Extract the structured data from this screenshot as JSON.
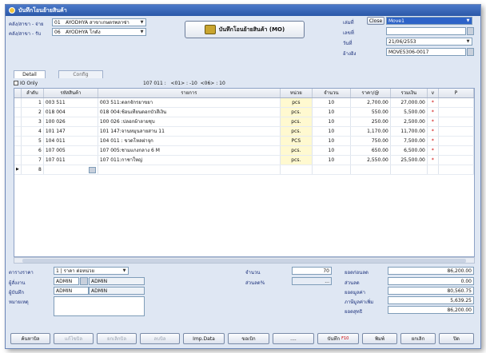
{
  "window": {
    "title": "บันทึกโอนย้ายสินค้า"
  },
  "header": {
    "from_label": "คลัง/สาขา - จ่าย",
    "from_code": "01",
    "from_name": "AYODHYA สาขาเกษตรพลาซ่า",
    "to_label": "คลัง/สาขา - รับ",
    "to_code": "06",
    "to_name": "AYODHYA โกดัง",
    "save_big_label": "บันทึกโอนย้ายสินค้า (MO)"
  },
  "doc": {
    "type_label": "เล่มที่",
    "close_label": "Close",
    "type_value": "Move1",
    "number_label": "เลขที่",
    "number_value": "",
    "date_label": "วันที่",
    "date_value": "21/06/2553",
    "ref_label": "อ้างอิง",
    "ref_value": "MOVE5306-0017"
  },
  "tabs": [
    {
      "label": "Detail"
    },
    {
      "label": "Config"
    }
  ],
  "io_only_label": "IO Only",
  "summary_line": "107 011 :   <01> : -10  <06> : 10",
  "columns": [
    "ลำดับ",
    "รหัสสินค้า",
    "รายการ",
    "หน่วย",
    "จำนวน",
    "ราคา/@",
    "รวมเงิน",
    "v",
    "P"
  ],
  "rows": [
    {
      "no": "1",
      "code": "003 511",
      "name": "003 511:ตลกจักรยาขยา",
      "unit": "pcs",
      "qty": "10",
      "price": "2,700.00",
      "total": "27,000.00",
      "v": "*"
    },
    {
      "no": "2",
      "code": "018 004",
      "name": "018 004:ช้อนเทียนดอกบัวสีเงิน",
      "unit": "pcs.",
      "qty": "10",
      "price": "550.00",
      "total": "5,500.00",
      "v": "*"
    },
    {
      "no": "3",
      "code": "100 026",
      "name": "100 026 :ปลอกผ้าลายชุบ",
      "unit": "pcs.",
      "qty": "10",
      "price": "250.00",
      "total": "2,500.00",
      "v": "*"
    },
    {
      "no": "4",
      "code": "101 147",
      "name": "101 147:จานหมุนลายสาน  11",
      "unit": "pcs.",
      "qty": "10",
      "price": "1,170.00",
      "total": "11,700.00",
      "v": "*"
    },
    {
      "no": "5",
      "code": "104 011",
      "name": "104 011 : ขวดโหลฝาจุก",
      "unit": "PCS",
      "qty": "10",
      "price": "750.00",
      "total": "7,500.00",
      "v": "*"
    },
    {
      "no": "6",
      "code": "107 005",
      "name": "107 005:ชามแกงกลาง  6    M",
      "unit": "pcs.",
      "qty": "10",
      "price": "650.00",
      "total": "6,500.00",
      "v": "*"
    },
    {
      "no": "7",
      "code": "107 011",
      "name": "107 011:กาชาใหญ่",
      "unit": "pcs.",
      "qty": "10",
      "price": "2,550.00",
      "total": "25,500.00",
      "v": "*"
    },
    {
      "no": "8",
      "code": "",
      "name": "",
      "unit": "",
      "qty": "",
      "price": "",
      "total": "",
      "v": ""
    }
  ],
  "bottom": {
    "price_level_label": "ตารางราคา",
    "price_level_value": "1 | ราคา ต่อหน่วย",
    "orderer_label": "ผู้สั่งงาน",
    "orderer_code": "ADMIN",
    "orderer_name": "ADMIN",
    "recorder_label": "ผู้บันทึก",
    "recorder_code": "ADMIN",
    "recorder_name": "ADMIN",
    "note_label": "หมายเหตุ",
    "qty_label": "จำนวน",
    "qty_value": "70",
    "discount_pct_label": "ส่วนลด%",
    "discount_pct_value": "...",
    "subtotal_label": "ยอดก่อนลด",
    "subtotal_value": "86,200.00",
    "discount_label": "ส่วนลด",
    "discount_value": "0.00",
    "net_value_label": "ยอดมูลค่า",
    "net_value_value": "80,560.75",
    "vat_label": "ภาษีมูลค่าเพิ่ม",
    "vat_value": "5,639.25",
    "grand_label": "ยอดสุทธิ",
    "grand_value": "86,200.00"
  },
  "buttons": {
    "search": "ค้นหาบิล",
    "edit": "แก้ไขบิล",
    "cancel_bill": "ยกเลิกบิล",
    "delete_bill": "ลบบิล",
    "imp_data": "Imp.Data",
    "request": "ขอเบิก",
    "dots": "....",
    "save": "บันทึก",
    "save_key": "F10",
    "print": "พิมพ์",
    "cancel": "ยกเลิก",
    "close": "ปิด"
  },
  "colors": {
    "title_bar": "#2b58a8",
    "selected_field": "#2d63c8",
    "window_bg": "#dfe7f3"
  }
}
